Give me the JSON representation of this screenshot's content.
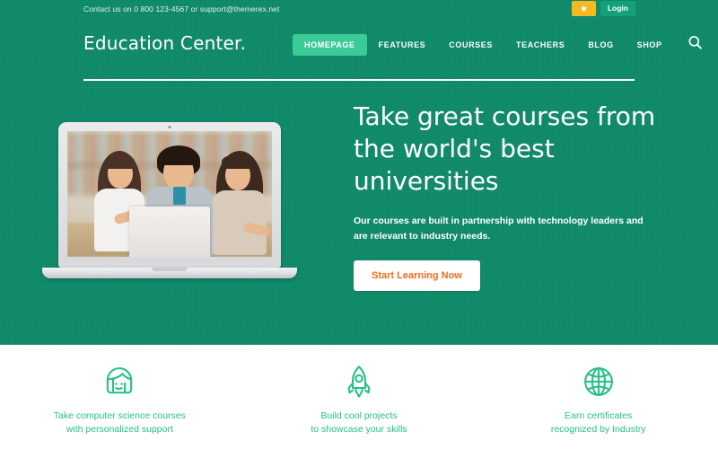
{
  "topbar": {
    "contact": "Contact us on 0 800 123-4567 or support@themerex.net",
    "star_button_icon": "star-icon",
    "login_label": "Login"
  },
  "header": {
    "logo": "Education Center.",
    "search_icon": "search-icon",
    "nav": [
      {
        "label": "HOMEPAGE",
        "active": true
      },
      {
        "label": "FEATURES",
        "active": false
      },
      {
        "label": "COURSES",
        "active": false
      },
      {
        "label": "TEACHERS",
        "active": false
      },
      {
        "label": "BLOG",
        "active": false
      },
      {
        "label": "SHOP",
        "active": false
      }
    ]
  },
  "hero": {
    "title": "Take great courses from the world's best universities",
    "subtitle": "Our courses are built in partnership with technology leaders and are relevant to industry needs.",
    "cta_label": "Start Learning Now",
    "image_alt": "Laptop showing three smiling students studying together at a library table"
  },
  "features": [
    {
      "icon": "girl-face-icon",
      "line1": "Take computer science courses",
      "line2": "with personalized support"
    },
    {
      "icon": "rocket-icon",
      "line1": "Build cool projects",
      "line2": "to showcase your skills"
    },
    {
      "icon": "globe-icon",
      "line1": "Earn certificates",
      "line2": "recognized by Industry"
    }
  ],
  "colors": {
    "brand_green": "#0c8a69",
    "accent_green": "#3ccb97",
    "feature_green": "#25c08a",
    "star_yellow": "#f5b921",
    "cta_orange": "#ef6c1a",
    "login_green": "#15a07a"
  }
}
